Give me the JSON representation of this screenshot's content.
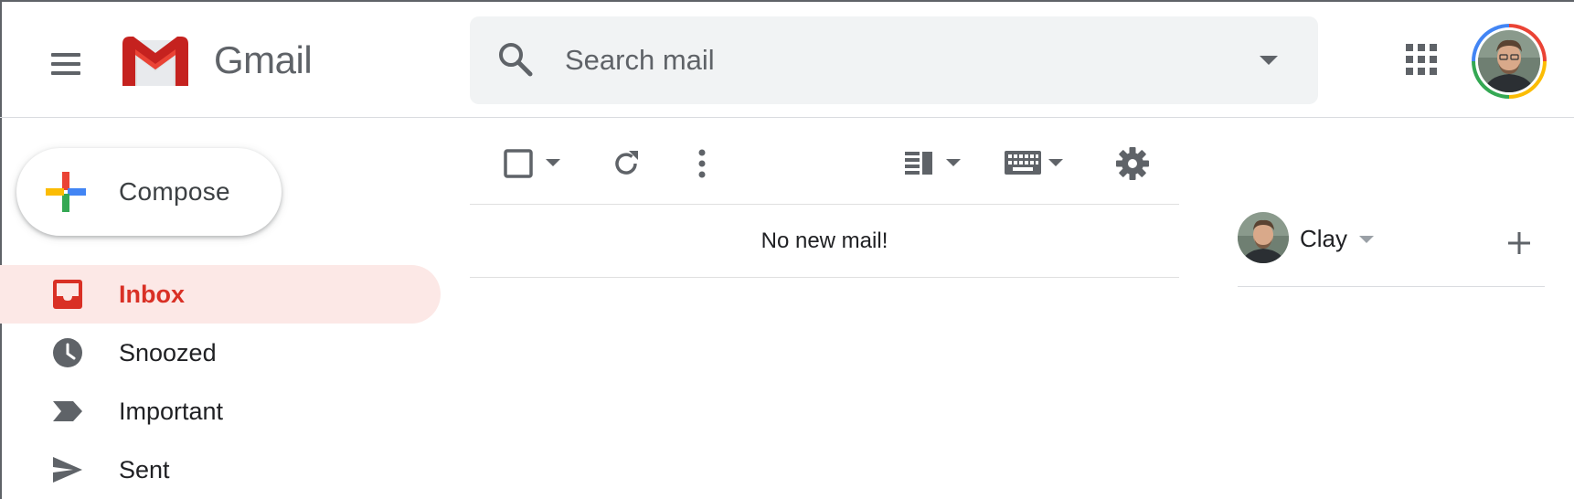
{
  "app": {
    "name": "Gmail"
  },
  "search": {
    "placeholder": "Search mail"
  },
  "compose": {
    "label": "Compose"
  },
  "nav": {
    "items": [
      {
        "label": "Inbox",
        "icon": "inbox-icon",
        "active": true
      },
      {
        "label": "Snoozed",
        "icon": "clock-icon",
        "active": false
      },
      {
        "label": "Important",
        "icon": "important-icon",
        "active": false
      },
      {
        "label": "Sent",
        "icon": "send-icon",
        "active": false
      }
    ]
  },
  "toolbar": {
    "icons": [
      "checkbox-icon",
      "chevron-down-icon",
      "refresh-icon",
      "more-vert-icon",
      "split-pane-icon",
      "keyboard-icon",
      "gear-icon"
    ]
  },
  "mail_list": {
    "empty_message": "No new mail!"
  },
  "chat": {
    "user_name": "Clay"
  },
  "colors": {
    "accent_red": "#d93025",
    "active_bg": "#fce8e6",
    "search_bg": "#f1f3f4",
    "icon_gray": "#5f6368"
  }
}
